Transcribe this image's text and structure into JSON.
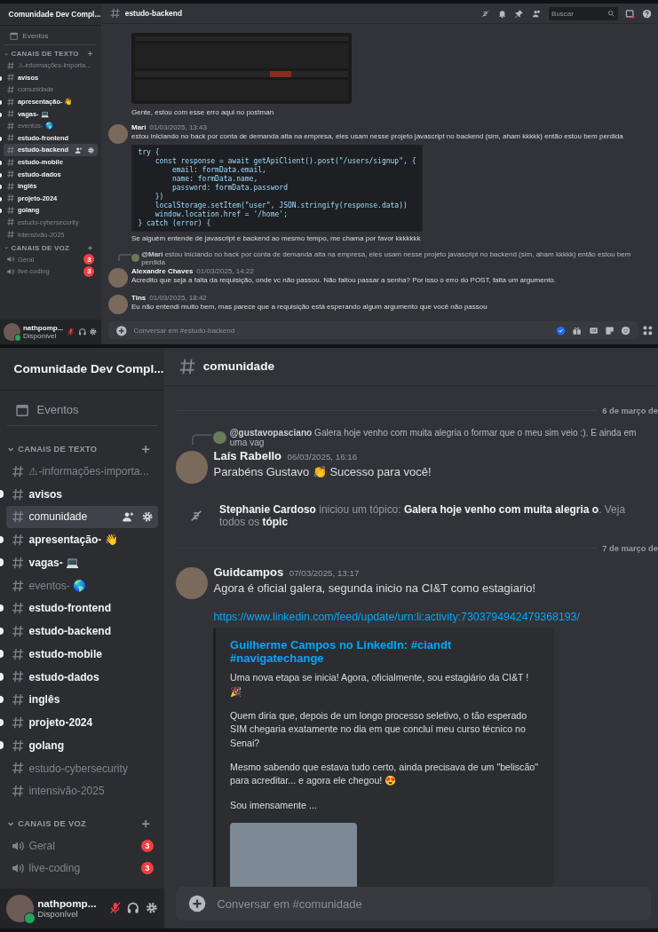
{
  "panels": [
    {
      "server_name": "Comunidade Dev Compl...",
      "events_label": "Eventos",
      "text_category": "CANAIS DE TEXTO",
      "channels": [
        {
          "name": "⚠-informações-importa...",
          "unread": false,
          "selected": false
        },
        {
          "name": "avisos",
          "unread": true,
          "selected": false
        },
        {
          "name": "comunidade",
          "unread": false,
          "selected": false
        },
        {
          "name": "apresentação- 👋",
          "unread": true,
          "selected": false
        },
        {
          "name": "vagas- 💻",
          "unread": true,
          "selected": false
        },
        {
          "name": "eventos- 🌎",
          "unread": false,
          "selected": false
        },
        {
          "name": "estudo-frontend",
          "unread": true,
          "selected": false
        },
        {
          "name": "estudo-backend",
          "unread": true,
          "selected": true
        },
        {
          "name": "estudo-mobile",
          "unread": true,
          "selected": false
        },
        {
          "name": "estudo-dados",
          "unread": true,
          "selected": false
        },
        {
          "name": "inglês",
          "unread": true,
          "selected": false
        },
        {
          "name": "projeto-2024",
          "unread": true,
          "selected": false
        },
        {
          "name": "golang",
          "unread": true,
          "selected": false
        },
        {
          "name": "estudo-cybersecurity",
          "unread": false,
          "selected": false
        },
        {
          "name": "intensivão-2025",
          "unread": false,
          "selected": false
        }
      ],
      "voice_category": "CANAIS DE VOZ",
      "voice_channels": [
        {
          "name": "Geral",
          "badge": "3"
        },
        {
          "name": "live-coding",
          "badge": "3"
        }
      ],
      "user": {
        "name": "nathpomp...",
        "status": "Disponível"
      },
      "channel_title": "estudo-backend",
      "search": {
        "placeholder": "Buscar"
      },
      "messages": [
        {
          "kind": "continuation",
          "parts": [
            {
              "kind": "image"
            },
            {
              "kind": "text",
              "text": "Gente, estou com esse erro aqui no postman"
            }
          ]
        },
        {
          "kind": "message",
          "author": "Mari",
          "time": "01/03/2025, 13:43",
          "parts": [
            {
              "kind": "text",
              "text": "estou iniciando no back por conta de demanda alta na empresa, eles usam nesse projeto javascript no backend (sim, aham kkkkk) então estou bem perdida"
            },
            {
              "kind": "code",
              "lines": [
                "try {",
                "    const response = await getApiClient().post(\"/users/signup\", {",
                "        email: formData.email,",
                "        name: formData.name,",
                "        password: formData.password",
                "    })",
                "    localStorage.setItem(\"user\", JSON.stringify(response.data))",
                "    window.location.href = '/home';",
                "} catch (error) {"
              ]
            },
            {
              "kind": "text",
              "text": "Se alguém entende de javascript e backend ao mesmo tempo, me chama por favor kkkkkkk"
            }
          ]
        },
        {
          "kind": "message",
          "author": "Alexandre Chaves",
          "time": "01/03/2025, 14:22",
          "reply": {
            "name": "@Mari",
            "text": "estou iniciando no back por conta de demanda alta na empresa, eles usam nesse projeto javascript no backend (sim, aham kkkkk) então estou bem perdida"
          },
          "parts": [
            {
              "kind": "text",
              "text": "Acredito que seja a falta da requisição, onde vc não passou. Não faltou passar a senha? Por isso o erro do POST, falta um argumento."
            }
          ]
        },
        {
          "kind": "message",
          "author": "Tins",
          "time": "01/03/2025, 18:42",
          "parts": [
            {
              "kind": "text",
              "text": "Eu não entendi muito bem, mas parece que a requisição está esperando algum argumento que você não passou"
            }
          ]
        }
      ],
      "composer": {
        "placeholder": "Conversar em #estudo-backend",
        "tools": true
      }
    },
    {
      "server_name": "Comunidade Dev Compl...",
      "events_label": "Eventos",
      "text_category": "CANAIS DE TEXTO",
      "channels": [
        {
          "name": "⚠-informações-importa...",
          "unread": false,
          "selected": false
        },
        {
          "name": "avisos",
          "unread": true,
          "selected": false
        },
        {
          "name": "comunidade",
          "unread": false,
          "selected": true
        },
        {
          "name": "apresentação- 👋",
          "unread": true,
          "selected": false
        },
        {
          "name": "vagas- 💻",
          "unread": true,
          "selected": false
        },
        {
          "name": "eventos- 🌎",
          "unread": false,
          "selected": false
        },
        {
          "name": "estudo-frontend",
          "unread": true,
          "selected": false
        },
        {
          "name": "estudo-backend",
          "unread": true,
          "selected": false
        },
        {
          "name": "estudo-mobile",
          "unread": true,
          "selected": false
        },
        {
          "name": "estudo-dados",
          "unread": true,
          "selected": false
        },
        {
          "name": "inglês",
          "unread": true,
          "selected": false
        },
        {
          "name": "projeto-2024",
          "unread": true,
          "selected": false
        },
        {
          "name": "golang",
          "unread": true,
          "selected": false
        },
        {
          "name": "estudo-cybersecurity",
          "unread": false,
          "selected": false
        },
        {
          "name": "intensivão-2025",
          "unread": false,
          "selected": false
        }
      ],
      "voice_category": "CANAIS DE VOZ",
      "voice_channels": [
        {
          "name": "Geral",
          "badge": "3"
        },
        {
          "name": "live-coding",
          "badge": "3"
        }
      ],
      "user": {
        "name": "nathpomp...",
        "status": "Disponível"
      },
      "channel_title": "comunidade",
      "messages": [
        {
          "kind": "divider",
          "text": "6 de março de"
        },
        {
          "kind": "message",
          "author": "Laís Rabello",
          "time": "06/03/2025, 16:16",
          "reply": {
            "name": "@gustavopasciano",
            "text": "Galera hoje venho com muita alegria o formar que o meu sim veio :). E ainda em uma vag"
          },
          "parts": [
            {
              "kind": "text",
              "text": "Parabéns Gustavo 👏 Sucesso para você!"
            }
          ]
        },
        {
          "kind": "system",
          "text": "**Stephanie Cardoso** iniciou um tópico: **Galera hoje venho com muita alegria o**. Veja todos os **tópic**"
        },
        {
          "kind": "divider",
          "text": "7 de março de"
        },
        {
          "kind": "message",
          "author": "Guidcampos",
          "time": "07/03/2025, 13:17",
          "parts": [
            {
              "kind": "text",
              "text": "Agora é oficial galera, segunda inicio na CI&T como estagiario!"
            },
            {
              "kind": "link",
              "text": "https://www.linkedin.com/feed/update/urn:li:activity:7303794942479368193/"
            },
            {
              "kind": "embed",
              "title": "Guilherme Campos no LinkedIn: #ciandt #navigatechange",
              "paragraphs": [
                "Uma nova etapa se inicia! Agora, oficialmente, sou estagiário da CI&T ! 🎉",
                "Quem diria que, depois de um longo processo seletivo, o tão esperado SIM chegaria exatamente no dia em que concluí meu curso técnico no Senai?",
                "Mesmo sabendo que estava tudo certo, ainda precisava de um \"beliscão\" para acreditar... e agora ele chegou! 😍",
                "Sou imensamente ..."
              ]
            }
          ]
        }
      ],
      "composer": {
        "placeholder": "Conversar em #comunidade",
        "tools": false
      }
    }
  ]
}
